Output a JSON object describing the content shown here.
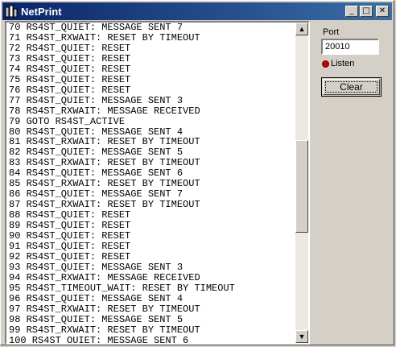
{
  "window": {
    "title": "NetPrint",
    "minimize_glyph": "_",
    "maximize_glyph": "□",
    "close_glyph": "✕"
  },
  "log": {
    "lines": [
      "70 RS4ST_QUIET: MESSAGE SENT 7",
      "71 RS4ST_RXWAIT: RESET BY TIMEOUT",
      "72 RS4ST_QUIET: RESET",
      "73 RS4ST_QUIET: RESET",
      "74 RS4ST_QUIET: RESET",
      "75 RS4ST_QUIET: RESET",
      "76 RS4ST_QUIET: RESET",
      "77 RS4ST_QUIET: MESSAGE SENT 3",
      "78 RS4ST_RXWAIT: MESSAGE RECEIVED",
      "79 GOTO RS4ST_ACTIVE",
      "80 RS4ST_QUIET: MESSAGE SENT 4",
      "81 RS4ST_RXWAIT: RESET BY TIMEOUT",
      "82 RS4ST_QUIET: MESSAGE SENT 5",
      "83 RS4ST_RXWAIT: RESET BY TIMEOUT",
      "84 RS4ST_QUIET: MESSAGE SENT 6",
      "85 RS4ST_RXWAIT: RESET BY TIMEOUT",
      "86 RS4ST_QUIET: MESSAGE SENT 7",
      "87 RS4ST_RXWAIT: RESET BY TIMEOUT",
      "88 RS4ST_QUIET: RESET",
      "89 RS4ST_QUIET: RESET",
      "90 RS4ST_QUIET: RESET",
      "91 RS4ST_QUIET: RESET",
      "92 RS4ST_QUIET: RESET",
      "93 RS4ST_QUIET: MESSAGE SENT 3",
      "94 RS4ST_RXWAIT: MESSAGE RECEIVED",
      "95 RS4ST_TIMEOUT_WAIT: RESET BY TIMEOUT",
      "96 RS4ST_QUIET: MESSAGE SENT 4",
      "97 RS4ST_RXWAIT: RESET BY TIMEOUT",
      "98 RS4ST_QUIET: MESSAGE SENT 5",
      "99 RS4ST_RXWAIT: RESET BY TIMEOUT",
      "100 RS4ST_QUIET: MESSAGE SENT 6"
    ]
  },
  "scrollbar": {
    "up_glyph": "▲",
    "down_glyph": "▼"
  },
  "panel": {
    "port_label": "Port",
    "port_value": "20010",
    "listen_label": "Listen",
    "clear_label": "Clear"
  },
  "colors": {
    "titlebar_start": "#0a246a",
    "titlebar_end": "#3a6ea5",
    "face": "#d4d0c8",
    "led": "#c80000"
  },
  "icons": {
    "app": "netprint-app-icon",
    "led": "listen-status-led"
  }
}
